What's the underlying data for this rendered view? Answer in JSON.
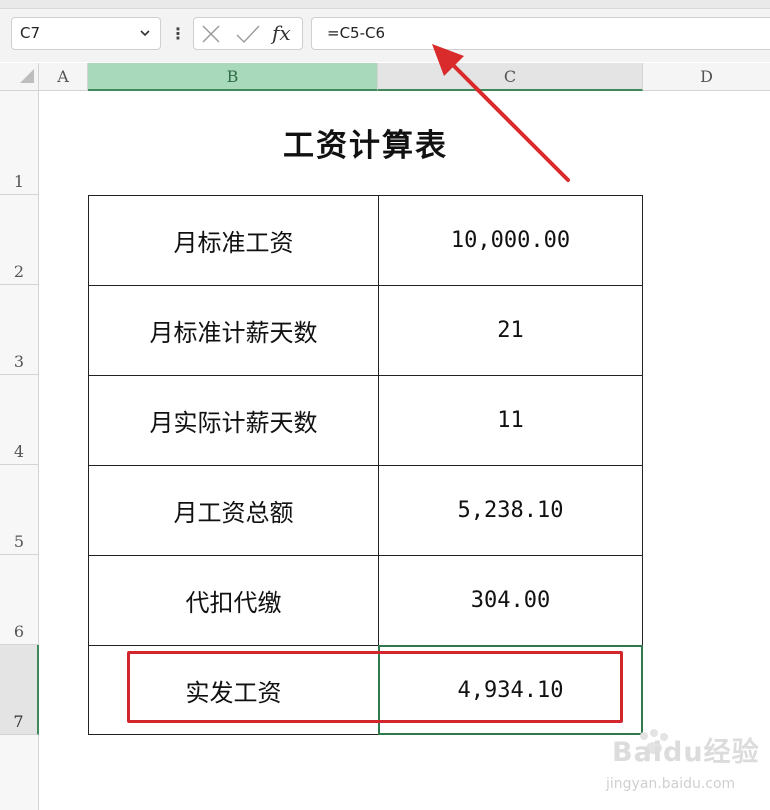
{
  "formula_bar": {
    "name_box": "C7",
    "fx_label": "fx",
    "formula": "=C5-C6"
  },
  "columns": [
    "A",
    "B",
    "C",
    "D"
  ],
  "rows": [
    "1",
    "2",
    "3",
    "4",
    "5",
    "6",
    "7"
  ],
  "sheet": {
    "title": "工资计算表",
    "table": [
      {
        "label": "月标准工资",
        "value": "10,000.00"
      },
      {
        "label": "月标准计薪天数",
        "value": "21"
      },
      {
        "label": "月实际计薪天数",
        "value": "11"
      },
      {
        "label": "月工资总额",
        "value": "5,238.10"
      },
      {
        "label": "代扣代缴",
        "value": "304.00"
      },
      {
        "label": "实发工资",
        "value": "4,934.10"
      }
    ]
  },
  "watermark": {
    "brand": "Baidu经验",
    "url": "jingyan.baidu.com"
  },
  "colors": {
    "selection_green": "#2f7a4b",
    "highlight_red": "#d2262c",
    "header_selected": "#a9d9bb"
  }
}
